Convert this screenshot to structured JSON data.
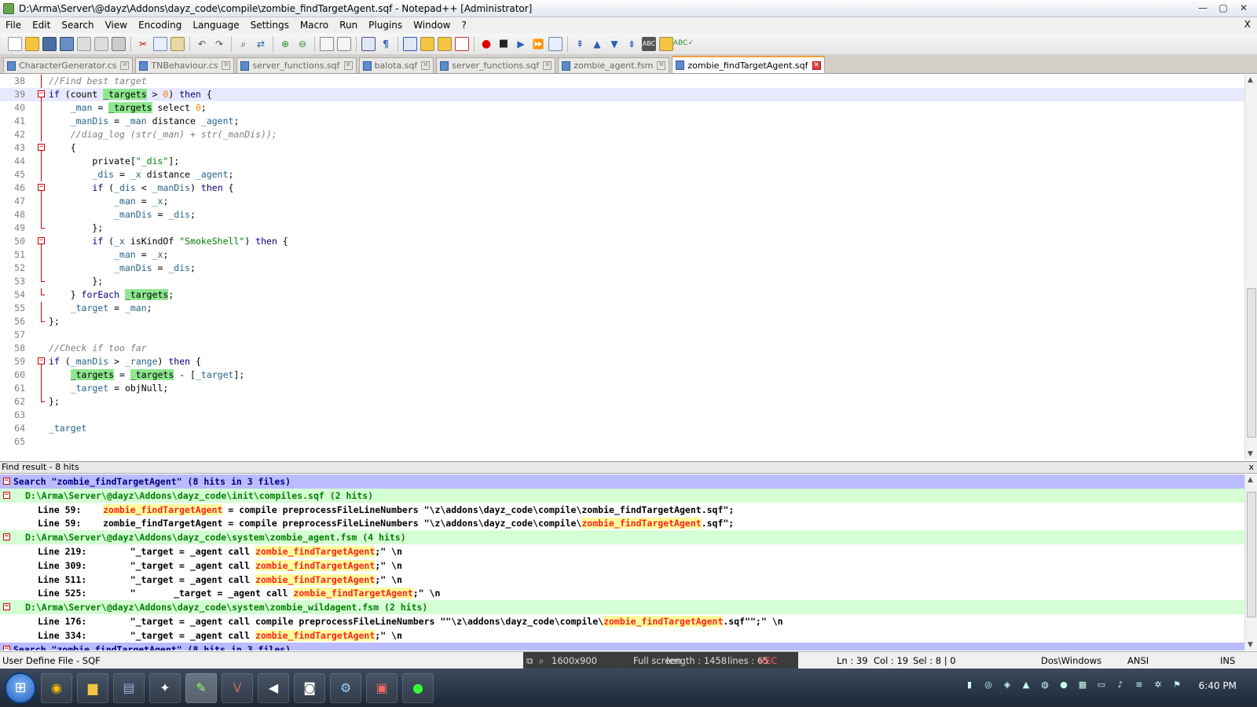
{
  "window": {
    "title": "D:\\Arma\\Server\\@dayz\\Addons\\dayz_code\\compile\\zombie_findTargetAgent.sqf - Notepad++ [Administrator]",
    "minimize": "—",
    "maximize": "▢",
    "close": "✕"
  },
  "menu": {
    "items": [
      "File",
      "Edit",
      "Search",
      "View",
      "Encoding",
      "Language",
      "Settings",
      "Macro",
      "Run",
      "Plugins",
      "Window",
      "?"
    ],
    "close_doc": "X"
  },
  "tabs": [
    {
      "label": "CharacterGenerator.cs",
      "active": false
    },
    {
      "label": "TNBehaviour.cs",
      "active": false
    },
    {
      "label": "server_functions.sqf",
      "active": false
    },
    {
      "label": "balota.sqf",
      "active": false
    },
    {
      "label": "server_functions.sqf",
      "active": false
    },
    {
      "label": "zombie_agent.fsm",
      "active": false
    },
    {
      "label": "zombie_findTargetAgent.sqf",
      "active": true
    }
  ],
  "editor": {
    "current_line": 39,
    "lines": [
      {
        "n": 38,
        "fold": "line",
        "tokens": [
          [
            "com",
            "//Find best target"
          ]
        ]
      },
      {
        "n": 39,
        "fold": "box",
        "tokens": [
          [
            "kw",
            "if"
          ],
          [
            "p",
            " (count "
          ],
          [
            "hl",
            "_targets"
          ],
          [
            "p",
            " > "
          ],
          [
            "num",
            "0"
          ],
          [
            "p",
            ") "
          ],
          [
            "kw",
            "then"
          ],
          [
            "p",
            " {"
          ]
        ]
      },
      {
        "n": 40,
        "fold": "line",
        "tokens": [
          [
            "p",
            "    "
          ],
          [
            "var",
            "_man"
          ],
          [
            "p",
            " = "
          ],
          [
            "hl",
            "_targets"
          ],
          [
            "p",
            " select "
          ],
          [
            "num",
            "0"
          ],
          [
            "p",
            ";"
          ]
        ]
      },
      {
        "n": 41,
        "fold": "line",
        "tokens": [
          [
            "p",
            "    "
          ],
          [
            "var",
            "_manDis"
          ],
          [
            "p",
            " = "
          ],
          [
            "var",
            "_man"
          ],
          [
            "p",
            " distance "
          ],
          [
            "var",
            "_agent"
          ],
          [
            "p",
            ";"
          ]
        ]
      },
      {
        "n": 42,
        "fold": "line",
        "tokens": [
          [
            "p",
            "    "
          ],
          [
            "com",
            "//diag_log (str(_man) + str(_manDis));"
          ]
        ]
      },
      {
        "n": 43,
        "fold": "box",
        "tokens": [
          [
            "p",
            "    {"
          ]
        ]
      },
      {
        "n": 44,
        "fold": "line",
        "tokens": [
          [
            "p",
            "        private["
          ],
          [
            "str",
            "\"_dis\""
          ],
          [
            "p",
            "];"
          ]
        ]
      },
      {
        "n": 45,
        "fold": "line",
        "tokens": [
          [
            "p",
            "        "
          ],
          [
            "var",
            "_dis"
          ],
          [
            "p",
            " = "
          ],
          [
            "var",
            "_x"
          ],
          [
            "p",
            " distance "
          ],
          [
            "var",
            "_agent"
          ],
          [
            "p",
            ";"
          ]
        ]
      },
      {
        "n": 46,
        "fold": "box",
        "tokens": [
          [
            "p",
            "        "
          ],
          [
            "kw",
            "if"
          ],
          [
            "p",
            " ("
          ],
          [
            "var",
            "_dis"
          ],
          [
            "p",
            " < "
          ],
          [
            "var",
            "_manDis"
          ],
          [
            "p",
            ") "
          ],
          [
            "kw",
            "then"
          ],
          [
            "p",
            " {"
          ]
        ]
      },
      {
        "n": 47,
        "fold": "line",
        "tokens": [
          [
            "p",
            "            "
          ],
          [
            "var",
            "_man"
          ],
          [
            "p",
            " = "
          ],
          [
            "var",
            "_x"
          ],
          [
            "p",
            ";"
          ]
        ]
      },
      {
        "n": 48,
        "fold": "line",
        "tokens": [
          [
            "p",
            "            "
          ],
          [
            "var",
            "_manDis"
          ],
          [
            "p",
            " = "
          ],
          [
            "var",
            "_dis"
          ],
          [
            "p",
            ";"
          ]
        ]
      },
      {
        "n": 49,
        "fold": "end",
        "tokens": [
          [
            "p",
            "        };"
          ]
        ]
      },
      {
        "n": 50,
        "fold": "box",
        "tokens": [
          [
            "p",
            "        "
          ],
          [
            "kw",
            "if"
          ],
          [
            "p",
            " ("
          ],
          [
            "var",
            "_x"
          ],
          [
            "p",
            " isKindOf "
          ],
          [
            "str",
            "\"SmokeShell\""
          ],
          [
            "p",
            ") "
          ],
          [
            "kw",
            "then"
          ],
          [
            "p",
            " {"
          ]
        ]
      },
      {
        "n": 51,
        "fold": "line",
        "tokens": [
          [
            "p",
            "            "
          ],
          [
            "var",
            "_man"
          ],
          [
            "p",
            " = "
          ],
          [
            "var",
            "_x"
          ],
          [
            "p",
            ";"
          ]
        ]
      },
      {
        "n": 52,
        "fold": "line",
        "tokens": [
          [
            "p",
            "            "
          ],
          [
            "var",
            "_manDis"
          ],
          [
            "p",
            " = "
          ],
          [
            "var",
            "_dis"
          ],
          [
            "p",
            ";"
          ]
        ]
      },
      {
        "n": 53,
        "fold": "end",
        "tokens": [
          [
            "p",
            "        };"
          ]
        ]
      },
      {
        "n": 54,
        "fold": "end",
        "tokens": [
          [
            "p",
            "    } "
          ],
          [
            "kw",
            "forEach"
          ],
          [
            "p",
            " "
          ],
          [
            "hl",
            "_targets"
          ],
          [
            "p",
            ";"
          ]
        ]
      },
      {
        "n": 55,
        "fold": "line",
        "tokens": [
          [
            "p",
            "    "
          ],
          [
            "var",
            "_target"
          ],
          [
            "p",
            " = "
          ],
          [
            "var",
            "_man"
          ],
          [
            "p",
            ";"
          ]
        ]
      },
      {
        "n": 56,
        "fold": "end",
        "tokens": [
          [
            "p",
            "};"
          ]
        ]
      },
      {
        "n": 57,
        "fold": "none",
        "tokens": []
      },
      {
        "n": 58,
        "fold": "none",
        "tokens": [
          [
            "com",
            "//Check if too far"
          ]
        ]
      },
      {
        "n": 59,
        "fold": "box",
        "tokens": [
          [
            "kw",
            "if"
          ],
          [
            "p",
            " ("
          ],
          [
            "var",
            "_manDis"
          ],
          [
            "p",
            " > "
          ],
          [
            "var",
            "_range"
          ],
          [
            "p",
            ") "
          ],
          [
            "kw",
            "then"
          ],
          [
            "p",
            " {"
          ]
        ]
      },
      {
        "n": 60,
        "fold": "line",
        "tokens": [
          [
            "p",
            "    "
          ],
          [
            "hl",
            "_targets"
          ],
          [
            "p",
            " = "
          ],
          [
            "hl",
            "_targets"
          ],
          [
            "p",
            " - ["
          ],
          [
            "var",
            "_target"
          ],
          [
            "p",
            "];"
          ]
        ]
      },
      {
        "n": 61,
        "fold": "line",
        "tokens": [
          [
            "p",
            "    "
          ],
          [
            "var",
            "_target"
          ],
          [
            "p",
            " = objNull;"
          ]
        ]
      },
      {
        "n": 62,
        "fold": "end",
        "tokens": [
          [
            "p",
            "};"
          ]
        ]
      },
      {
        "n": 63,
        "fold": "none",
        "tokens": []
      },
      {
        "n": 64,
        "fold": "none",
        "tokens": [
          [
            "var",
            "_target"
          ]
        ]
      },
      {
        "n": 65,
        "fold": "none",
        "tokens": []
      }
    ]
  },
  "find_panel": {
    "title": "Find result - 8 hits",
    "close": "x",
    "lines": [
      {
        "kind": "head",
        "fold": "−",
        "parts": [
          [
            "t",
            "Search \"zombie_findTargetAgent\" (8 hits in 3 files)"
          ]
        ]
      },
      {
        "kind": "file",
        "fold": "−",
        "parts": [
          [
            "t",
            "D:\\Arma\\Server\\@dayz\\Addons\\dayz_code\\init\\compiles.sqf (2 hits)"
          ]
        ]
      },
      {
        "kind": "hit",
        "parts": [
          [
            "t",
            "Line 59:    "
          ],
          [
            "m",
            "zombie_findTargetAgent"
          ],
          [
            "t",
            " = compile preprocessFileLineNumbers \"\\z\\addons\\dayz_code\\compile\\zombie_findTargetAgent.sqf\";"
          ]
        ]
      },
      {
        "kind": "hit",
        "parts": [
          [
            "t",
            "Line 59:    zombie_findTargetAgent = compile preprocessFileLineNumbers \"\\z\\addons\\dayz_code\\compile\\"
          ],
          [
            "m",
            "zombie_findTargetAgent"
          ],
          [
            "t",
            ".sqf\";"
          ]
        ]
      },
      {
        "kind": "file",
        "fold": "−",
        "parts": [
          [
            "t",
            "D:\\Arma\\Server\\@dayz\\Addons\\dayz_code\\system\\zombie_agent.fsm (4 hits)"
          ]
        ]
      },
      {
        "kind": "hit",
        "parts": [
          [
            "t",
            "Line 219:        \"_target = _agent call "
          ],
          [
            "m",
            "zombie_findTargetAgent"
          ],
          [
            "t",
            ";\" \\n"
          ]
        ]
      },
      {
        "kind": "hit",
        "parts": [
          [
            "t",
            "Line 309:        \"_target = _agent call "
          ],
          [
            "m",
            "zombie_findTargetAgent"
          ],
          [
            "t",
            ";\" \\n"
          ]
        ]
      },
      {
        "kind": "hit",
        "parts": [
          [
            "t",
            "Line 511:        \"_target = _agent call "
          ],
          [
            "m",
            "zombie_findTargetAgent"
          ],
          [
            "t",
            ";\" \\n"
          ]
        ]
      },
      {
        "kind": "hit",
        "parts": [
          [
            "t",
            "Line 525:        \"       _target = _agent call "
          ],
          [
            "m",
            "zombie_findTargetAgent"
          ],
          [
            "t",
            ";\" \\n"
          ]
        ]
      },
      {
        "kind": "file",
        "fold": "−",
        "parts": [
          [
            "t",
            "D:\\Arma\\Server\\@dayz\\Addons\\dayz_code\\system\\zombie_wildagent.fsm (2 hits)"
          ]
        ]
      },
      {
        "kind": "hit",
        "parts": [
          [
            "t",
            "Line 176:        \"_target = _agent call compile preprocessFileLineNumbers \"\"\\z\\addons\\dayz_code\\compile\\"
          ],
          [
            "m",
            "zombie_findTargetAgent"
          ],
          [
            "t",
            ".sqf\"\";\" \\n"
          ]
        ]
      },
      {
        "kind": "hit",
        "parts": [
          [
            "t",
            "Line 334:        \"_target = _agent call "
          ],
          [
            "m",
            "zombie_findTargetAgent"
          ],
          [
            "t",
            ";\" \\n"
          ]
        ]
      },
      {
        "kind": "head",
        "fold": "−",
        "parts": [
          [
            "t",
            "Search \"zombie_findTargetAgent\" (8 hits in 3 files)"
          ]
        ]
      }
    ]
  },
  "status": {
    "language": "User Define File - SQF",
    "resolution": "1600x900",
    "fullscreen": "Full screen",
    "length": "length : 1458",
    "lines": "lines : 65",
    "rec": "REC",
    "ln": "Ln : 39",
    "col": "Col : 19",
    "sel": "Sel : 8 | 0",
    "eol": "Dos\\Windows",
    "encoding": "ANSI",
    "mode": "INS"
  },
  "taskbar": {
    "clock": "6:40 PM",
    "apps": [
      "chrome-icon",
      "folder-icon",
      "notepad-icon",
      "puzzle-icon",
      "notepadpp-icon",
      "visual-studio-icon",
      "winamp-icon",
      "camera-icon",
      "steam-icon",
      "game-icon",
      "razer-icon"
    ]
  },
  "colors": {
    "highlight": "#8fe88f",
    "keyword": "#000080",
    "variable": "#26638a",
    "string": "#008000",
    "number": "#ff8000",
    "search_head": "#bbbbff",
    "search_file": "#d5ffd5",
    "search_mark": "#ff2020"
  }
}
